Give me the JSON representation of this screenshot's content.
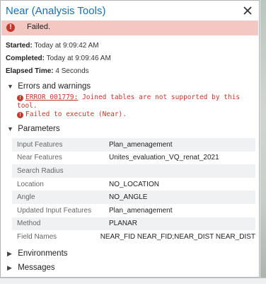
{
  "window": {
    "title": "Near (Analysis Tools)",
    "close_icon": "close-icon"
  },
  "status": {
    "text": "Failed.",
    "icon": "error-icon",
    "color": "#c4372c",
    "banner_color": "#f3c8c3"
  },
  "meta": {
    "started_label": "Started:",
    "started_value": "Today at 9:09:42 AM",
    "completed_label": "Completed:",
    "completed_value": "Today at 9:09:46 AM",
    "elapsed_label": "Elapsed Time:",
    "elapsed_value": "4 Seconds"
  },
  "errors": {
    "heading": "Errors and warnings",
    "messages": [
      {
        "code": "ERROR 001779:",
        "text": " Joined tables are not supported by this tool."
      },
      {
        "code": "",
        "text": "Failed to execute (Near)."
      }
    ]
  },
  "parameters": {
    "heading": "Parameters",
    "rows": [
      {
        "name": "Input Features",
        "value": "Plan_amenagement"
      },
      {
        "name": "Near Features",
        "value": "Unites_evaluation_VQ_renat_2021"
      },
      {
        "name": "Search Radius",
        "value": ""
      },
      {
        "name": "Location",
        "value": "NO_LOCATION"
      },
      {
        "name": "Angle",
        "value": "NO_ANGLE"
      },
      {
        "name": "Updated Input Features",
        "value": "Plan_amenagement"
      },
      {
        "name": "Method",
        "value": "PLANAR"
      },
      {
        "name": "Field Names",
        "value": "NEAR_FID NEAR_FID;NEAR_DIST NEAR_DIST"
      }
    ]
  },
  "environments": {
    "heading": "Environments"
  },
  "messages": {
    "heading": "Messages"
  },
  "colors": {
    "title": "#1470b8",
    "error_text": "#c8372b"
  }
}
